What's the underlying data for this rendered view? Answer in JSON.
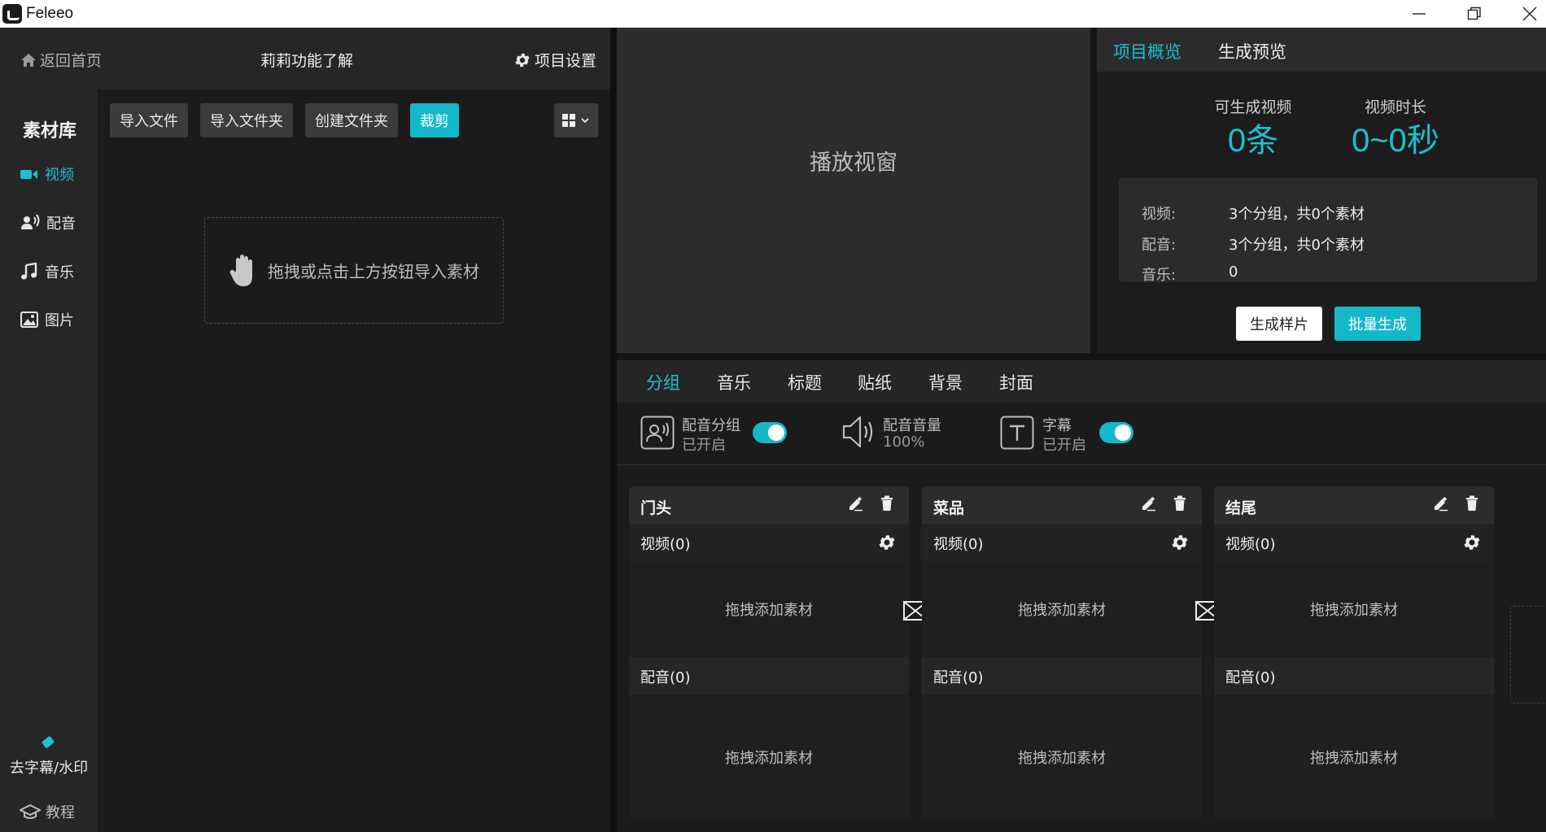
{
  "window": {
    "title": "Feleeo",
    "minimize_label": "",
    "accent": "#1cc0cf"
  },
  "header": {
    "back_label": "返回首页",
    "project_name": "莉莉功能了解",
    "settings_label": "项目设置"
  },
  "sidebar": {
    "title": "素材库",
    "items": [
      {
        "label": "视频",
        "icon": "video-camera-icon"
      },
      {
        "label": "配音",
        "icon": "voice-icon"
      },
      {
        "label": "音乐",
        "icon": "music-note-icon"
      },
      {
        "label": "图片",
        "icon": "image-icon"
      }
    ],
    "remove_subtitle_label": "去字幕/水印",
    "tutorial_label": "教程"
  },
  "library": {
    "import_file": "导入文件",
    "import_folder": "导入文件夹",
    "create_folder": "创建文件夹",
    "crop": "裁剪",
    "drop_hint": "拖拽或点击上方按钮导入素材"
  },
  "player": {
    "placeholder": "播放视窗"
  },
  "overview": {
    "tabs": [
      "项目概览",
      "生成预览"
    ],
    "stats": [
      {
        "label": "可生成视频",
        "value": "0条"
      },
      {
        "label": "视频时长",
        "value": "0~0秒"
      }
    ],
    "info": [
      {
        "key": "视频:",
        "value": "3个分组，共0个素材"
      },
      {
        "key": "配音:",
        "value": "3个分组，共0个素材"
      },
      {
        "key": "音乐:",
        "value": "0"
      }
    ],
    "sample_button": "生成样片",
    "batch_button": "批量生成"
  },
  "editor": {
    "tabs": [
      "分组",
      "音乐",
      "标题",
      "贴纸",
      "背景",
      "封面"
    ],
    "options": [
      {
        "title": "配音分组",
        "sub": "已开启",
        "icon": "voice-group-icon"
      },
      {
        "title": "配音音量",
        "sub": "100%",
        "icon": "speaker-icon"
      },
      {
        "title": "字幕",
        "sub": "已开启",
        "icon": "text-icon"
      }
    ],
    "groups": [
      {
        "name": "门头",
        "video": "视频(0)",
        "voice": "配音(0)",
        "drop": "拖拽添加素材"
      },
      {
        "name": "菜品",
        "video": "视频(0)",
        "voice": "配音(0)",
        "drop": "拖拽添加素材"
      },
      {
        "name": "结尾",
        "video": "视频(0)",
        "voice": "配音(0)",
        "drop": "拖拽添加素材"
      }
    ]
  }
}
